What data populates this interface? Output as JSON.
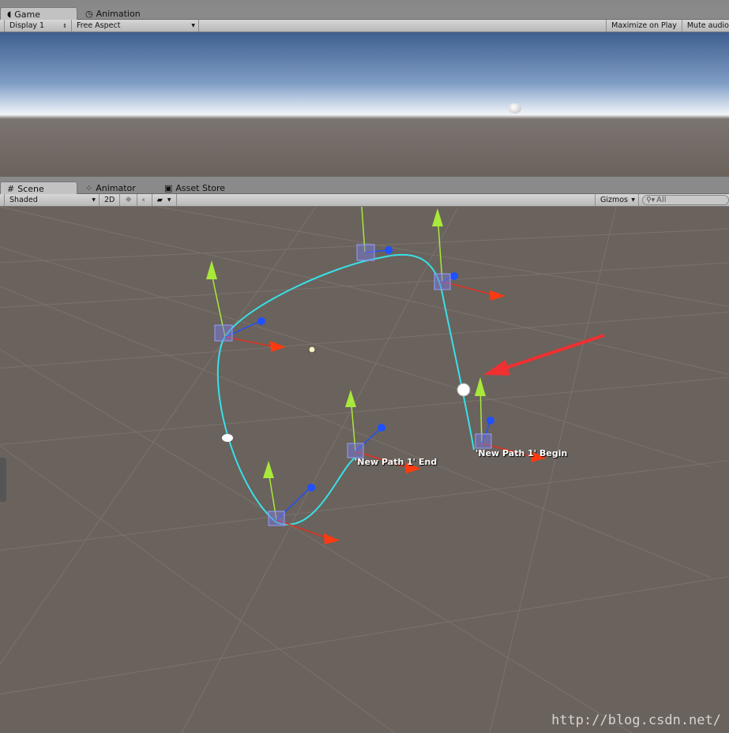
{
  "game_panel": {
    "tabs": [
      {
        "label": "Game",
        "icon": "pacman-icon"
      },
      {
        "label": "Animation",
        "icon": "clock-icon"
      }
    ],
    "display": "Display 1",
    "aspect": "Free Aspect",
    "maximize_on_play": "Maximize on Play",
    "mute_audio": "Mute audio"
  },
  "scene_panel": {
    "tabs": [
      {
        "label": "Scene",
        "icon": "grid-icon"
      },
      {
        "label": "Animator",
        "icon": "animator-icon"
      },
      {
        "label": "Asset Store",
        "icon": "bag-icon"
      }
    ],
    "shading_mode": "Shaded",
    "mode_2d": "2D",
    "gizmos": "Gizmos",
    "search_placeholder": "All"
  },
  "scene_labels": {
    "path_end": "'New Path 1' End",
    "path_begin": "'New Path 1' Begin"
  },
  "watermark": "http://blog.csdn.net/",
  "colors": {
    "path": "#38e0e8",
    "arrow_red": "#ff3a10",
    "arrow_green": "#a8e83a",
    "arrow_blue": "#2050ff",
    "annotation": "#f03030"
  }
}
